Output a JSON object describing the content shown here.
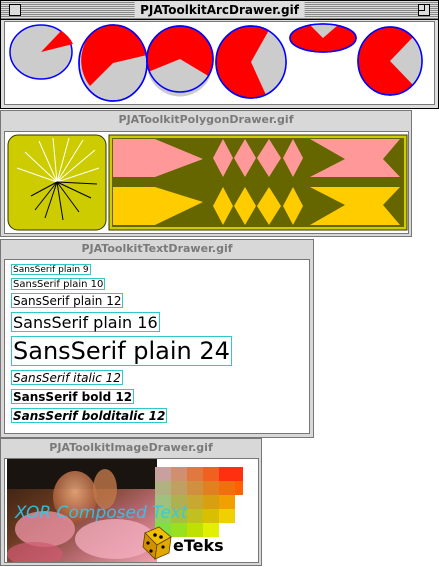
{
  "windows": {
    "arc": {
      "title": "PJAToolkitArcDrawer.gif"
    },
    "polygon": {
      "title": "PJAToolkitPolygonDrawer.gif"
    },
    "text": {
      "title": "PJAToolkitTextDrawer.gif"
    },
    "image": {
      "title": "PJAToolkitImageDrawer.gif"
    }
  },
  "text_samples": [
    {
      "label": "SansSerif plain 9"
    },
    {
      "label": "SansSerif plain 10"
    },
    {
      "label": "SansSerif plain 12"
    },
    {
      "label": "SansSerif plain 16"
    },
    {
      "label": "SansSerif plain 24"
    },
    {
      "label": "SansSerif italic 12"
    },
    {
      "label": "SansSerif bold 12"
    },
    {
      "label": "SansSerif bolditalic 12"
    }
  ],
  "image_window": {
    "overlay_text": "XOR Composed Text",
    "logo_text": "eTeks"
  },
  "colors": {
    "arc_fill_red": "#ff0000",
    "arc_fill_gray": "#cccccc",
    "arc_outline": "#0000ff",
    "pink": "#ff9999",
    "olive": "#666600",
    "yellow": "#ffcc00",
    "panel_yellow": "#cccc00",
    "text_box": "#33c8c8"
  }
}
